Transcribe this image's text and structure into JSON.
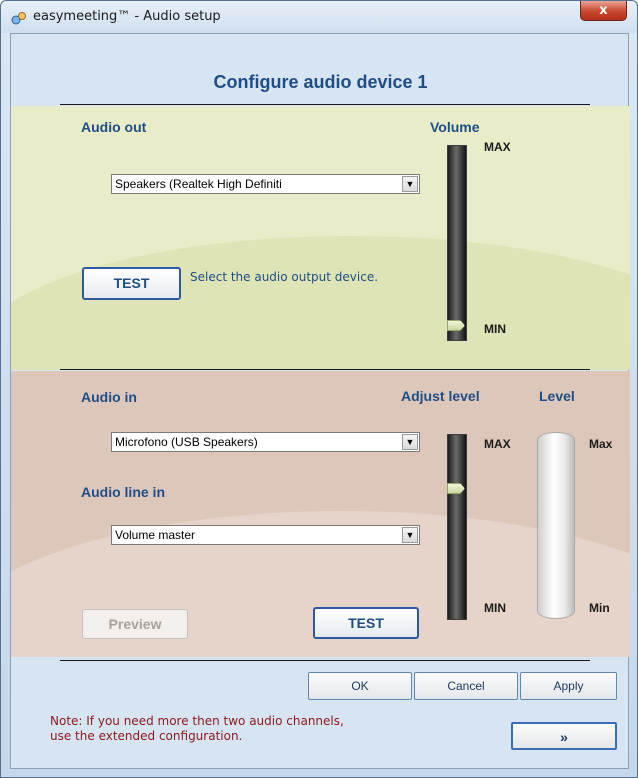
{
  "window": {
    "title": "easymeeting™ - Audio setup",
    "close_label": "x"
  },
  "header": {
    "title": "Configure audio device 1"
  },
  "audio_out": {
    "label": "Audio out",
    "volume_label": "Volume",
    "max_label": "MAX",
    "min_label": "MIN",
    "device": "Speakers (Realtek High Definiti",
    "test_label": "TEST",
    "hint": "Select the audio output device.",
    "volume_level": 0
  },
  "audio_in": {
    "label": "Audio in",
    "device": "Microfono (USB Speakers)",
    "line_in_label": "Audio line in",
    "line_in_value": "Volume master",
    "adjust_label": "Adjust level",
    "level_label": "Level",
    "max_label": "MAX",
    "min_label": "MIN",
    "level_max_label": "Max",
    "level_min_label": "Min",
    "preview_label": "Preview",
    "test_label": "TEST",
    "adjust_level": 0.8
  },
  "footer": {
    "ok_label": "OK",
    "cancel_label": "Cancel",
    "apply_label": "Apply",
    "note_line1": "Note: If you need more then two audio channels,",
    "note_line2": "use the extended configuration.",
    "extended_label": "»"
  },
  "colors": {
    "accent": "#1f4e86",
    "note": "#8b1a1a",
    "out_panel": "#e8ecc8",
    "in_panel": "#ddc7bb"
  },
  "icons": {
    "app": "easymeeting-app-icon",
    "close": "close-icon",
    "dropdown": "chevron-down-icon"
  }
}
